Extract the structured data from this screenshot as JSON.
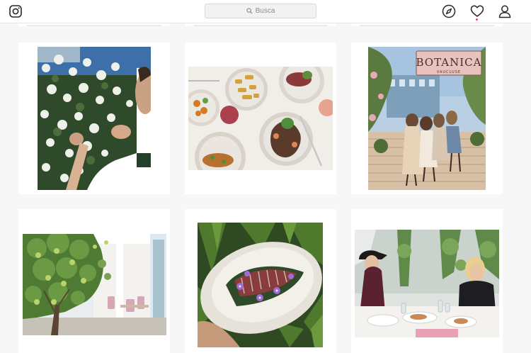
{
  "topbar": {
    "search_placeholder": "Busca",
    "icons": {
      "logo": "instagram-logo-icon",
      "explore": "compass-icon",
      "activity": "heart-icon",
      "profile": "user-icon"
    },
    "notification_color": "#ed4956"
  },
  "grid": {
    "posts": [
      {
        "subject": "Man tending jasmine flowers"
      },
      {
        "subject": "Table of plated dishes and wine"
      },
      {
        "subject": "Friends posing under Botanica Vaucluse sign",
        "sign_text": "BOTANICA",
        "sign_subtext": "VAUCLUSE"
      },
      {
        "subject": "Lime tree in front of dining terrace"
      },
      {
        "subject": "Seared tuna with purple flowers on white plate"
      },
      {
        "subject": "Two women laughing at dining table"
      }
    ]
  }
}
